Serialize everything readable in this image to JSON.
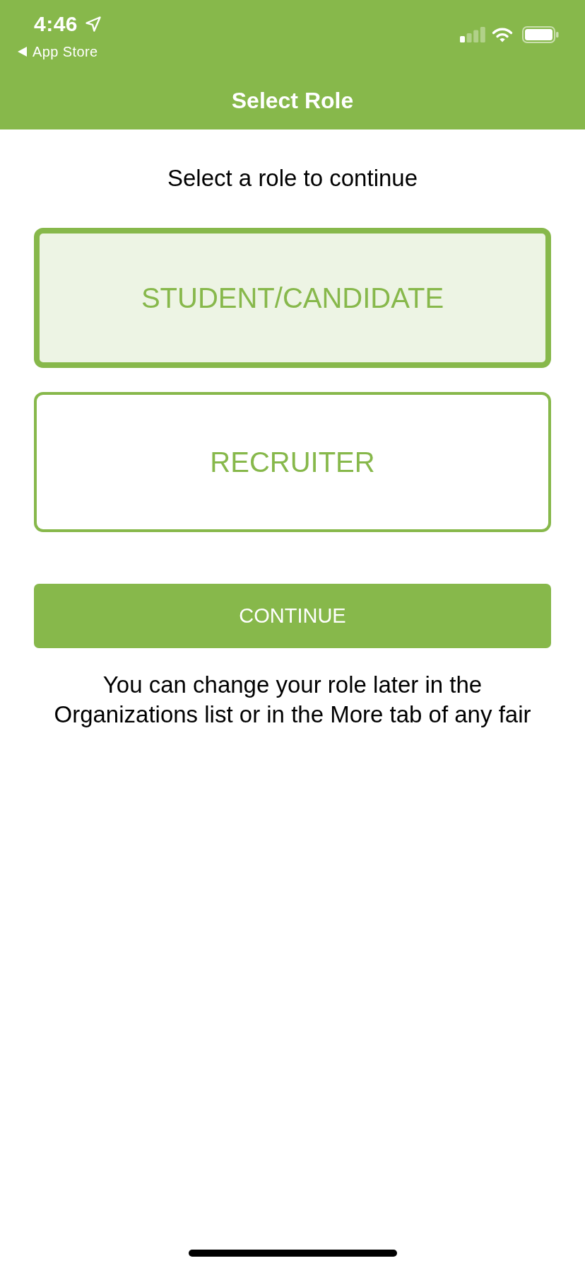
{
  "status_bar": {
    "time": "4:46",
    "back_label": "App Store"
  },
  "nav_bar": {
    "title": "Select Role"
  },
  "prompt": "Select a role to continue",
  "roles": [
    {
      "label": "STUDENT/CANDIDATE",
      "selected": true
    },
    {
      "label": "RECRUITER",
      "selected": false
    }
  ],
  "continue_button": {
    "label": "CONTINUE"
  },
  "note": "You can change your role later in the Organizations list or in the More tab of any fair"
}
